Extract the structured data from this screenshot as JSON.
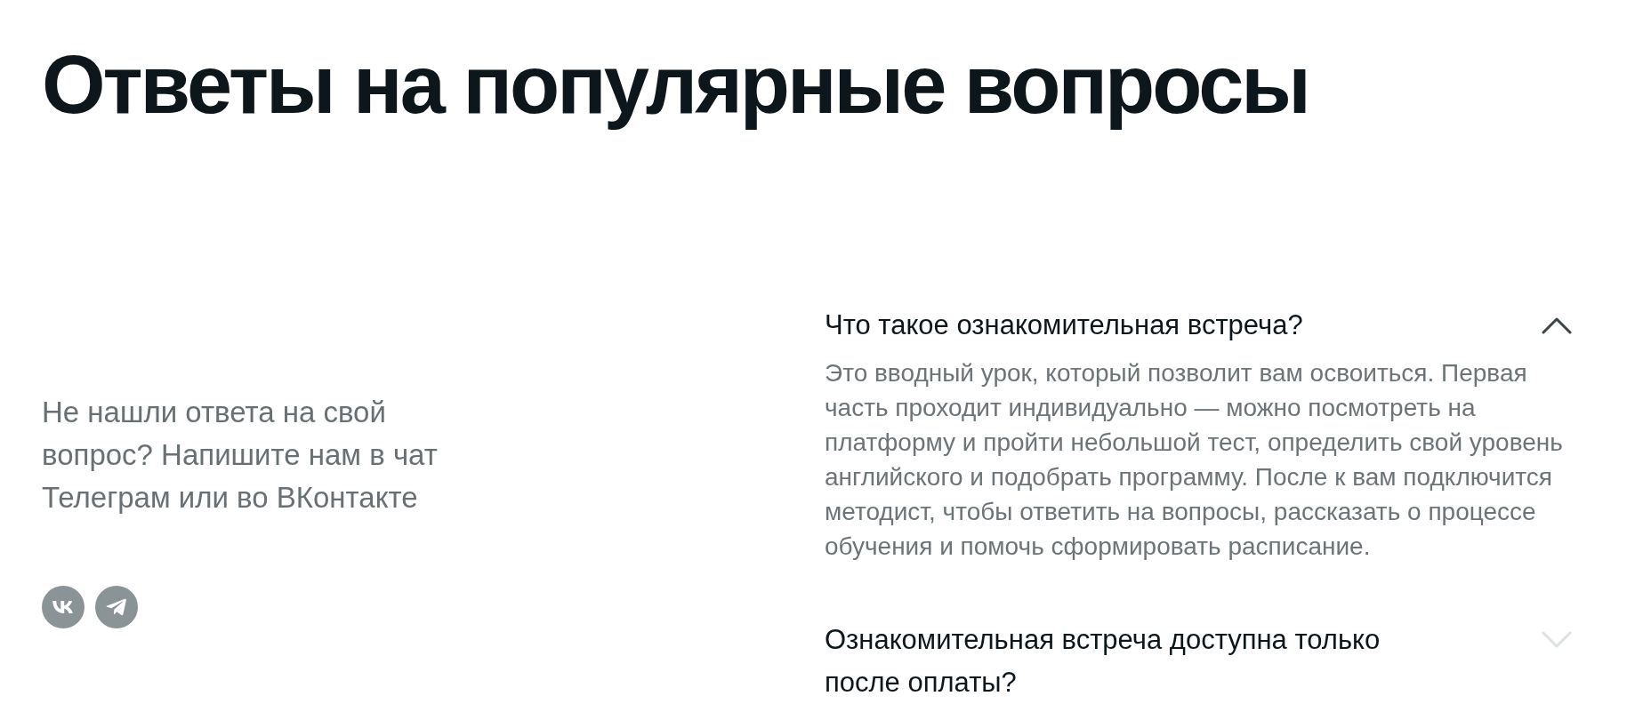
{
  "title": "Ответы на популярные вопросы",
  "contact": {
    "text": "Не нашли ответа на свой вопрос? Напишите нам в чат Телеграм или во ВКонтакте",
    "socials": [
      {
        "kind": "vk"
      },
      {
        "kind": "telegram"
      }
    ]
  },
  "faq": [
    {
      "question": "Что такое ознакомительная встреча?",
      "expanded": true,
      "answer": "Это вводный урок, который позволит вам освоиться. Первая часть проходит индивидуально — можно посмотреть на платформу и пройти небольшой тест, определить свой уровень английского и подобрать программу. После к вам подключится методист, чтобы ответить на вопросы, рассказать о процессе обучения и помочь сформировать расписание."
    },
    {
      "question": "Ознакомительная встреча доступна только после оплаты?",
      "expanded": false
    }
  ]
}
